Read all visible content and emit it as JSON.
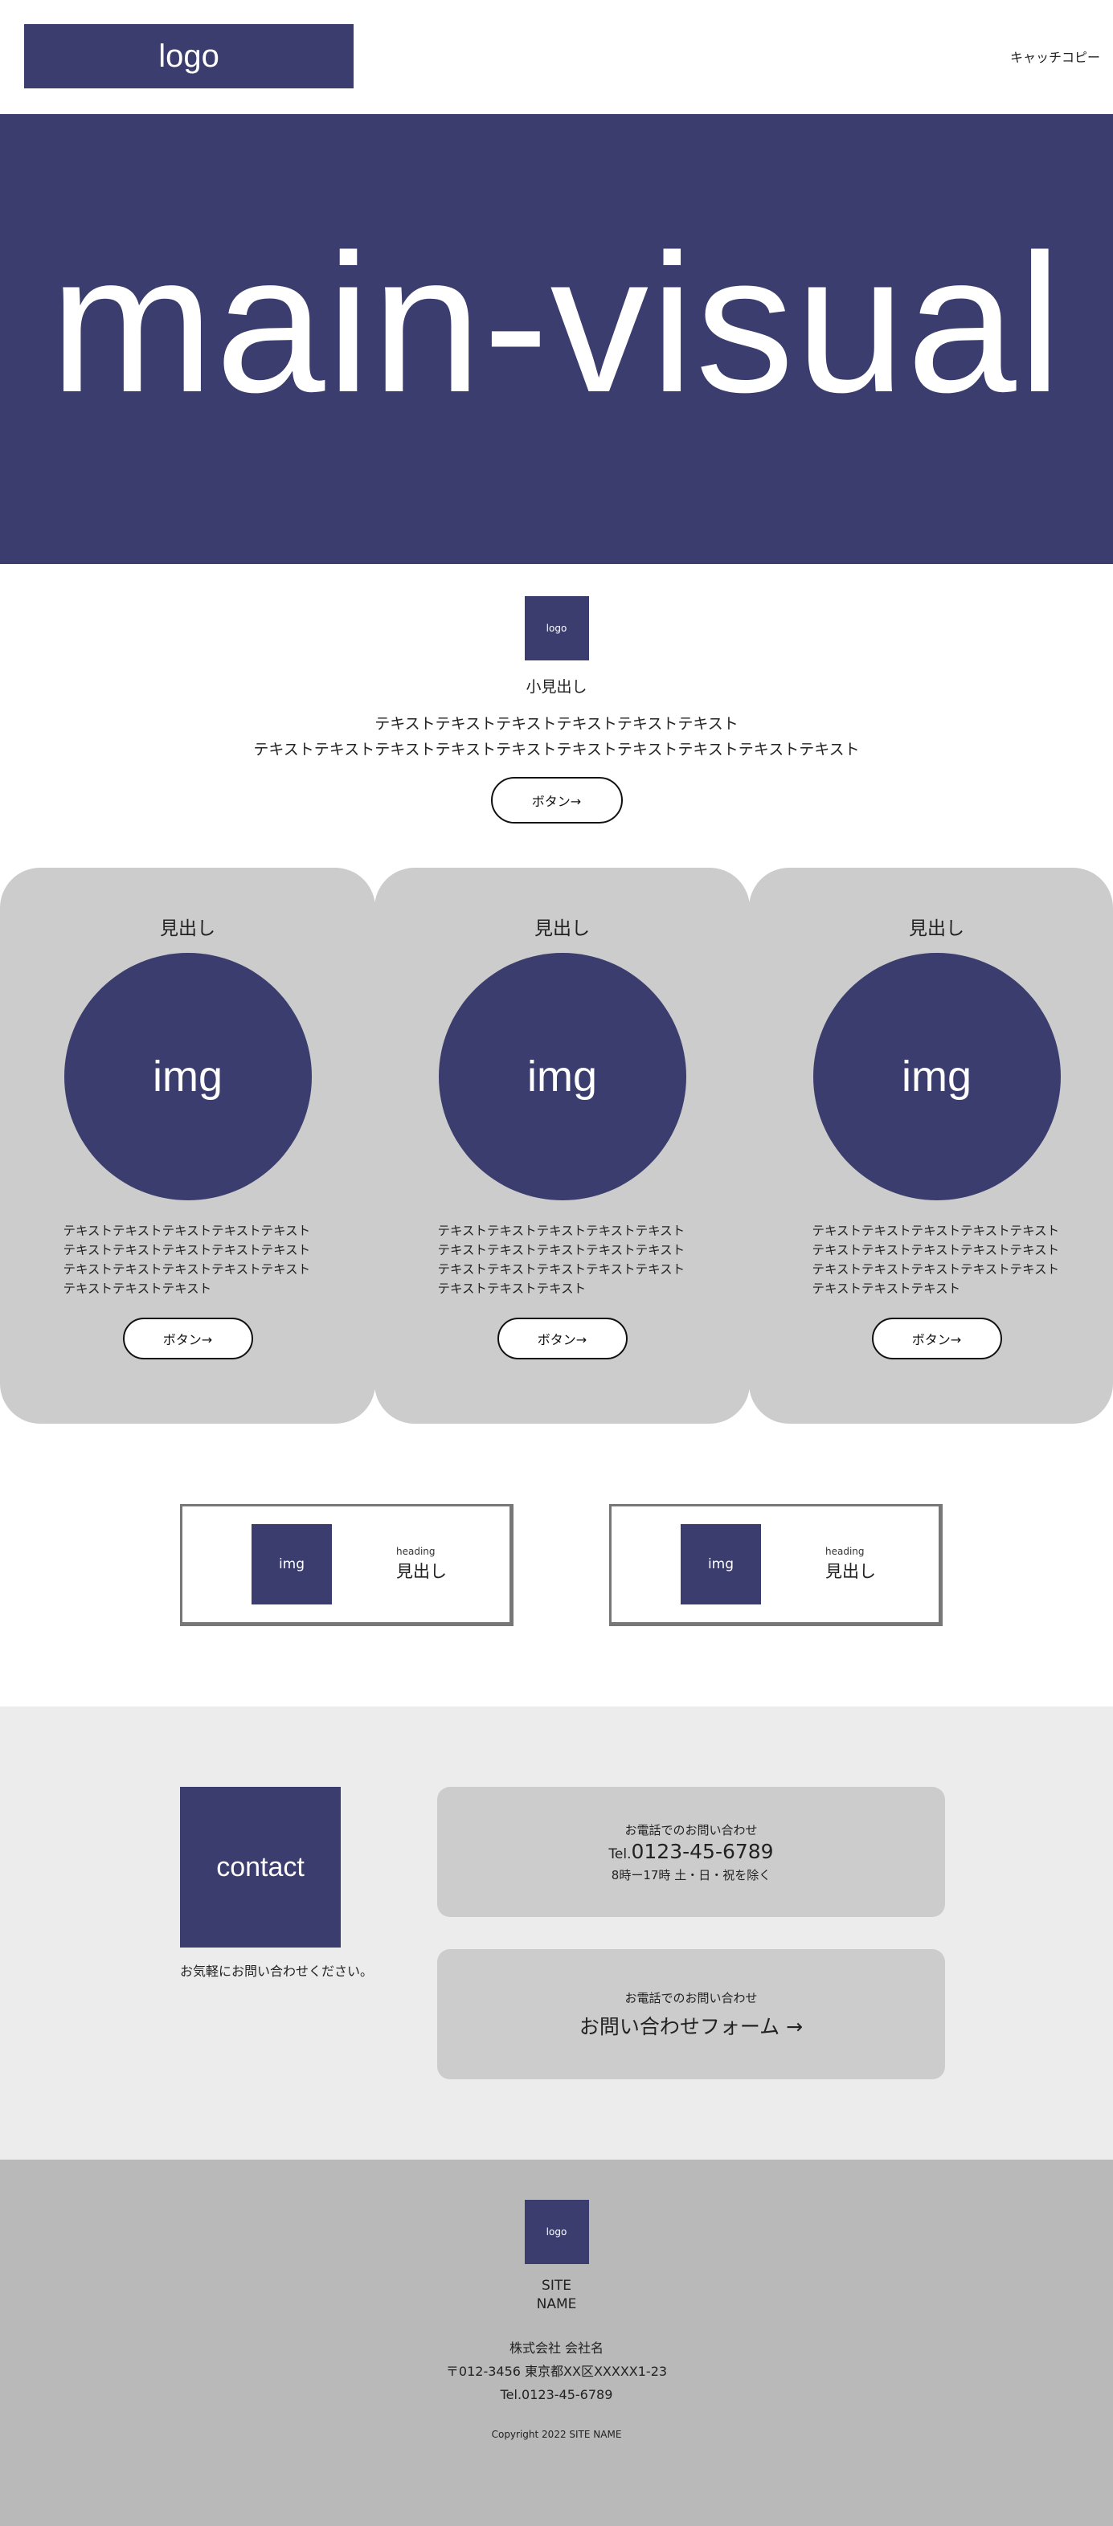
{
  "header": {
    "logo": "logo",
    "catchcopy": "キャッチコピー"
  },
  "main_visual": {
    "text": "main-visual"
  },
  "intro": {
    "logo": "logo",
    "subheading": "小見出し",
    "text_line1": "テキストテキストテキストテキストテキストテキスト",
    "text_line2": "テキストテキストテキストテキストテキストテキストテキストテキストテキストテキスト",
    "button": "ボタン→"
  },
  "cards": [
    {
      "heading": "見出し",
      "img": "img",
      "text": "テキストテキストテキストテキストテキストテキストテキストテキストテキストテキストテキストテキストテキストテキストテキストテキストテキストテキスト",
      "button": "ボタン→"
    },
    {
      "heading": "見出し",
      "img": "img",
      "text": "テキストテキストテキストテキストテキストテキストテキストテキストテキストテキストテキストテキストテキストテキストテキストテキストテキストテキスト",
      "button": "ボタン→"
    },
    {
      "heading": "見出し",
      "img": "img",
      "text": "テキストテキストテキストテキストテキストテキストテキストテキストテキストテキストテキストテキストテキストテキストテキストテキストテキストテキスト",
      "button": "ボタン→"
    }
  ],
  "features": [
    {
      "img": "img",
      "small": "heading",
      "heading": "見出し"
    },
    {
      "img": "img",
      "small": "heading",
      "heading": "見出し"
    }
  ],
  "contact": {
    "box": "contact",
    "note": "お気軽にお問い合わせください。",
    "phone_label": "お電話でのお問い合わせ",
    "tel_prefix": "Tel.",
    "tel_number": "0123-45-6789",
    "hours": "8時ー17時 土・日・祝を除く",
    "form_label": "お電話でのお問い合わせ",
    "form_link": "お問い合わせフォーム →"
  },
  "footer": {
    "logo": "logo",
    "site_name_line1": "SITE",
    "site_name_line2": "NAME",
    "company": "株式会社 会社名",
    "address": "〒012-3456 東京都XX区XXXXX1-23",
    "tel": "Tel.0123-45-6789",
    "copyright": "Copyright 2022 SITE NAME"
  },
  "colors": {
    "navy": "#3b3d6e",
    "card_gray": "#cccccc",
    "contact_bg": "#ececec",
    "footer_bg": "#b9b9b9"
  }
}
